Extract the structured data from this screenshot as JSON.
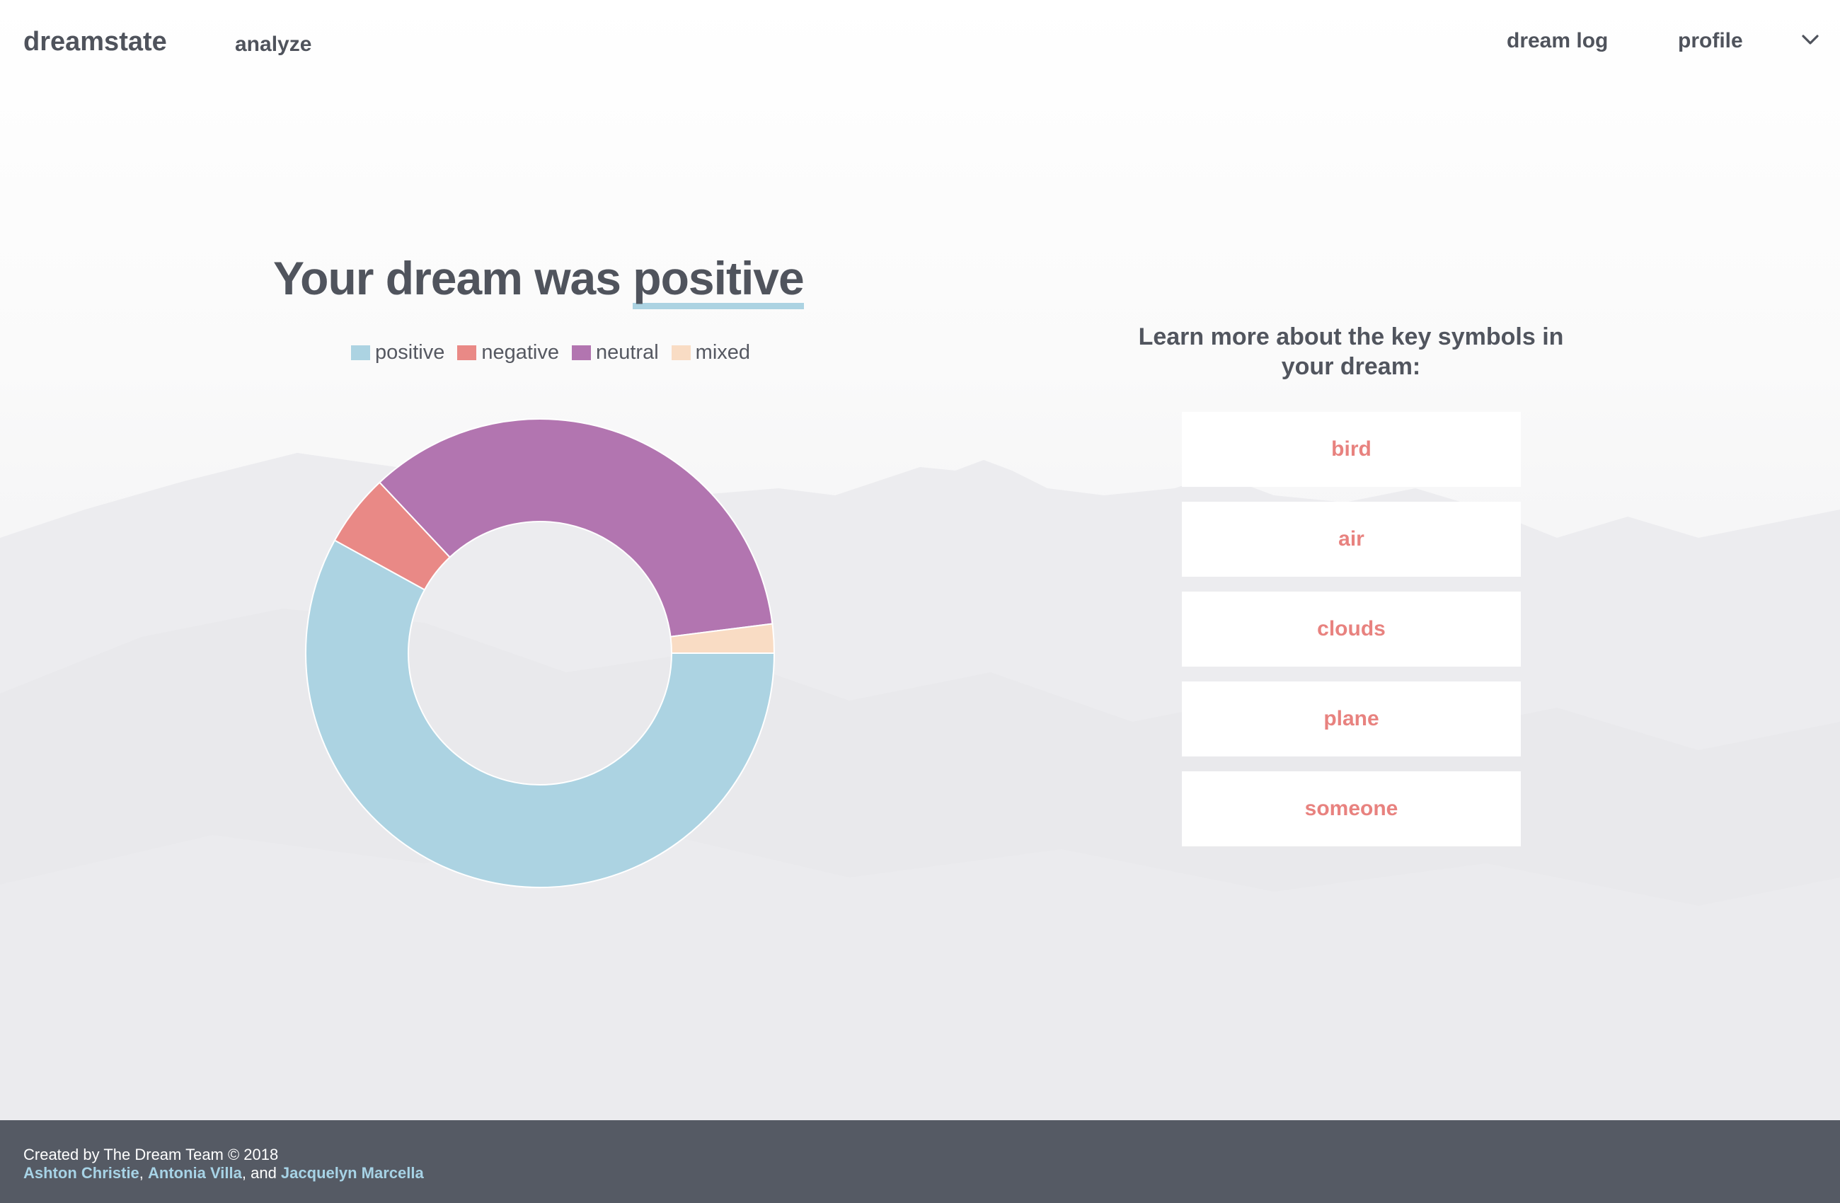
{
  "nav": {
    "brand": "dreamstate",
    "analyze": "analyze",
    "dream_log": "dream log",
    "profile": "profile",
    "profile_icon": "chevron-down-icon"
  },
  "result": {
    "headline_prefix": "Your dream was ",
    "sentiment": "positive"
  },
  "chart_data": {
    "type": "pie",
    "style": "doughnut",
    "categories": [
      "positive",
      "negative",
      "neutral",
      "mixed"
    ],
    "values": [
      58,
      5,
      35,
      2
    ],
    "colors": [
      "#acd3e2",
      "#e98986",
      "#b275b0",
      "#f9dcc4"
    ],
    "legend": "top"
  },
  "symbols": {
    "heading": "Learn more about the key symbols in your dream:",
    "items": [
      "bird",
      "air",
      "clouds",
      "plane",
      "someone"
    ]
  },
  "footer": {
    "created": "Created by The Dream Team © 2018",
    "authors": [
      "Ashton Christie",
      "Antonia Villa",
      "Jacquelyn Marcella"
    ],
    "sep1": ", ",
    "sep2": ", and "
  }
}
